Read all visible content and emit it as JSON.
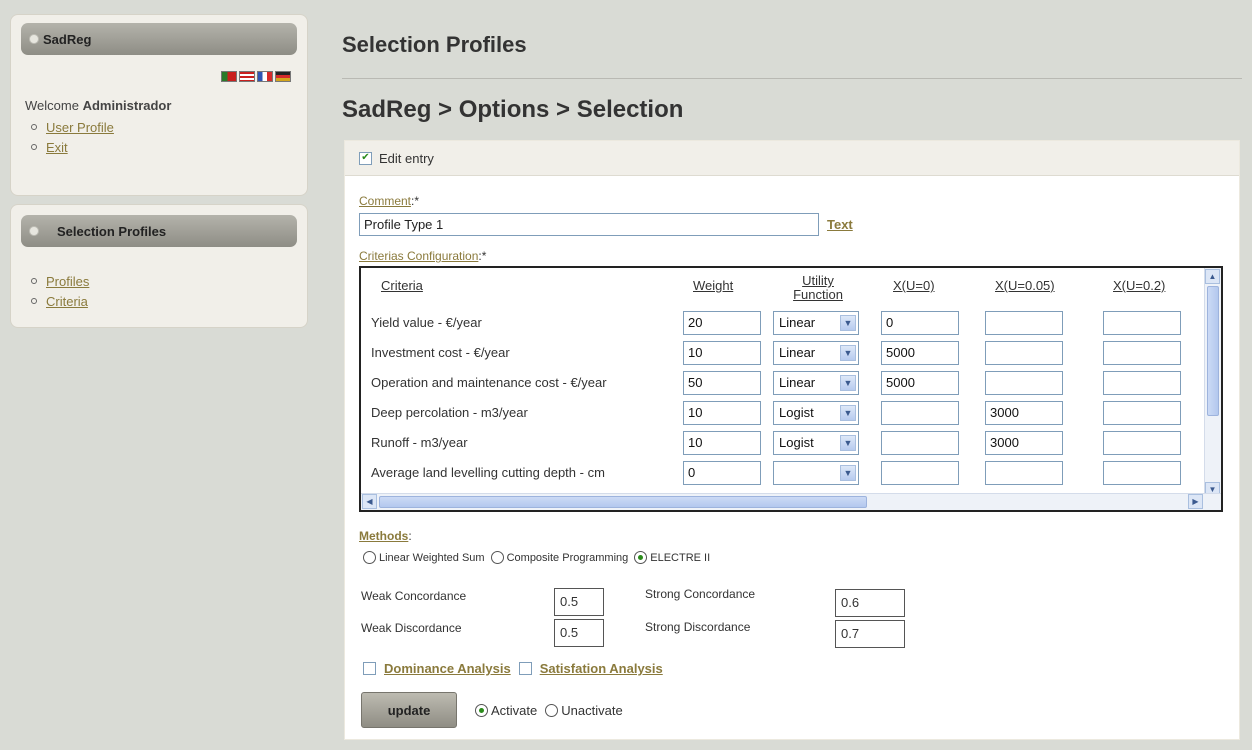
{
  "sidebar": {
    "top_panel": {
      "title": "SadReg",
      "flags": [
        {
          "name": "portugal",
          "color": "#c8201e"
        },
        {
          "name": "usa",
          "color": "#3b4f9a"
        },
        {
          "name": "france",
          "color": "#2e56b6"
        },
        {
          "name": "germany",
          "color": "#d3a41b"
        }
      ],
      "welcome_prefix": "Welcome",
      "welcome_user": "Administrador",
      "links": [
        "User Profile",
        "Exit"
      ]
    },
    "second_panel": {
      "title": "Selection Profiles",
      "links": [
        "Profiles",
        "Criteria"
      ]
    }
  },
  "main": {
    "page_title": "Selection Profiles",
    "breadcrumb": "SadReg > Options > Selection",
    "edit_entry_label": "Edit entry",
    "comment_label": "Comment",
    "required_mark": ":*",
    "comment_value": "Profile Type 1",
    "text_link": "Text",
    "criterias_label": "Criterias Configuration",
    "table": {
      "headers": {
        "criteria": "Criteria",
        "weight": "Weight",
        "utility_line1": "Utility",
        "utility_line2": "Function",
        "x0": "X(U=0)",
        "x005": "X(U=0.05)",
        "x02": "X(U=0.2)"
      },
      "rows": [
        {
          "criteria": "Yield value - €/year",
          "weight": "20",
          "function": "Linear",
          "x0": "0",
          "x005": "",
          "x02": ""
        },
        {
          "criteria": "Investment cost - €/year",
          "weight": "10",
          "function": "Linear",
          "x0": "5000",
          "x005": "",
          "x02": ""
        },
        {
          "criteria": "Operation and maintenance cost - €/year",
          "weight": "50",
          "function": "Linear",
          "x0": "5000",
          "x005": "",
          "x02": ""
        },
        {
          "criteria": "Deep percolation - m3/year",
          "weight": "10",
          "function": "Logist",
          "x0": "",
          "x005": "3000",
          "x02": ""
        },
        {
          "criteria": "Runoff - m3/year",
          "weight": "10",
          "function": "Logist",
          "x0": "",
          "x005": "3000",
          "x02": ""
        },
        {
          "criteria": "Average land levelling cutting depth - cm",
          "weight": "0",
          "function": "",
          "x0": "",
          "x005": "",
          "x02": ""
        }
      ]
    },
    "methods": {
      "label": "Methods",
      "options": [
        "Linear Weighted Sum",
        "Composite Programming",
        "ELECTRE II"
      ],
      "selected": "ELECTRE II"
    },
    "params": {
      "weak_concordance_label": "Weak Concordance",
      "weak_concordance": "0.5",
      "strong_concordance_label": "Strong Concordance",
      "strong_concordance": "0.6",
      "weak_discordance_label": "Weak Discordance",
      "weak_discordance": "0.5",
      "strong_discordance_label": "Strong Discordance",
      "strong_discordance": "0.7"
    },
    "analysis": {
      "dominance_label": "Dominance Analysis",
      "satisfaction_label": "Satisfation Analysis"
    },
    "update_label": "update",
    "activation": {
      "options": [
        "Activate",
        "Unactivate"
      ],
      "selected": "Activate"
    }
  }
}
